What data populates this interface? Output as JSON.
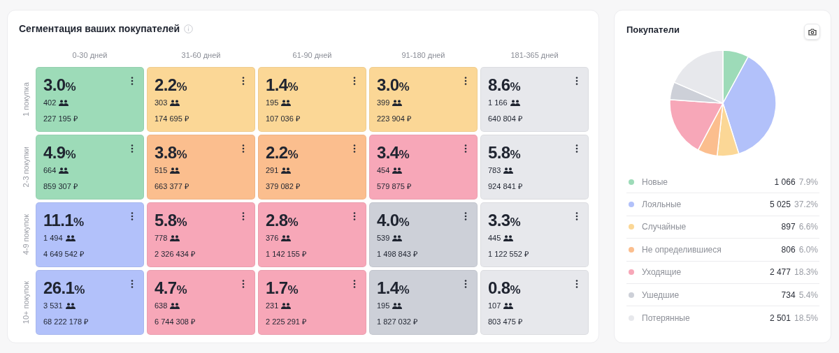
{
  "segmentation": {
    "title": "Сегментация ваших покупателей",
    "columns": [
      "0-30 дней",
      "31-60 дней",
      "61-90 дней",
      "91-180 дней",
      "181-365 дней"
    ],
    "rows": [
      {
        "label": "1 покупка",
        "cells": [
          {
            "value": "3.0",
            "unit": "%",
            "count": "402",
            "amount": "227 195 ₽",
            "color": "#9ddbb8"
          },
          {
            "value": "2.2",
            "unit": "%",
            "count": "303",
            "amount": "174 695 ₽",
            "color": "#fbd796"
          },
          {
            "value": "1.4",
            "unit": "%",
            "count": "195",
            "amount": "107 036 ₽",
            "color": "#fbd796"
          },
          {
            "value": "3.0",
            "unit": "%",
            "count": "399",
            "amount": "223 904 ₽",
            "color": "#fbd796"
          },
          {
            "value": "8.6",
            "unit": "%",
            "count": "1 166",
            "amount": "640 804 ₽",
            "color": "#e7e8ec"
          }
        ]
      },
      {
        "label": "2-3 покупки",
        "cells": [
          {
            "value": "4.9",
            "unit": "%",
            "count": "664",
            "amount": "859 307 ₽",
            "color": "#9ddbb8"
          },
          {
            "value": "3.8",
            "unit": "%",
            "count": "515",
            "amount": "663 377 ₽",
            "color": "#fbbe8e"
          },
          {
            "value": "2.2",
            "unit": "%",
            "count": "291",
            "amount": "379 082 ₽",
            "color": "#fbbe8e"
          },
          {
            "value": "3.4",
            "unit": "%",
            "count": "454",
            "amount": "579 875 ₽",
            "color": "#f7a7b8"
          },
          {
            "value": "5.8",
            "unit": "%",
            "count": "783",
            "amount": "924 841 ₽",
            "color": "#e7e8ec"
          }
        ]
      },
      {
        "label": "4-9 покупок",
        "cells": [
          {
            "value": "11.1",
            "unit": "%",
            "count": "1 494",
            "amount": "4 649 542 ₽",
            "color": "#b2c1fa"
          },
          {
            "value": "5.8",
            "unit": "%",
            "count": "778",
            "amount": "2 326 434 ₽",
            "color": "#f7a7b8"
          },
          {
            "value": "2.8",
            "unit": "%",
            "count": "376",
            "amount": "1 142 155 ₽",
            "color": "#f7a7b8"
          },
          {
            "value": "4.0",
            "unit": "%",
            "count": "539",
            "amount": "1 498 843 ₽",
            "color": "#cdd0d8"
          },
          {
            "value": "3.3",
            "unit": "%",
            "count": "445",
            "amount": "1 122 552 ₽",
            "color": "#e7e8ec"
          }
        ]
      },
      {
        "label": "10+ покупок",
        "cells": [
          {
            "value": "26.1",
            "unit": "%",
            "count": "3 531",
            "amount": "68 222 178 ₽",
            "color": "#b2c1fa"
          },
          {
            "value": "4.7",
            "unit": "%",
            "count": "638",
            "amount": "6 744 308 ₽",
            "color": "#f7a7b8"
          },
          {
            "value": "1.7",
            "unit": "%",
            "count": "231",
            "amount": "2 225 291 ₽",
            "color": "#f7a7b8"
          },
          {
            "value": "1.4",
            "unit": "%",
            "count": "195",
            "amount": "1 827 032 ₽",
            "color": "#cdd0d8"
          },
          {
            "value": "0.8",
            "unit": "%",
            "count": "107",
            "amount": "803 475 ₽",
            "color": "#e7e8ec"
          }
        ]
      }
    ]
  },
  "buyers": {
    "title": "Покупатели",
    "chart_data": {
      "type": "pie",
      "categories": [
        "Новые",
        "Лояльные",
        "Случайные",
        "Не определившиеся",
        "Уходящие",
        "Ушедшие",
        "Потерянные"
      ],
      "values": [
        7.9,
        37.2,
        6.6,
        6.0,
        18.3,
        5.4,
        18.5
      ]
    },
    "legend": [
      {
        "count": "1 066",
        "share": "7.9%",
        "color": "#9ddbb8"
      },
      {
        "count": "5 025",
        "share": "37.2%",
        "color": "#b2c1fa"
      },
      {
        "count": "897",
        "share": "6.6%",
        "color": "#fbd796"
      },
      {
        "count": "806",
        "share": "6.0%",
        "color": "#fbbe8e"
      },
      {
        "count": "2 477",
        "share": "18.3%",
        "color": "#f7a7b8"
      },
      {
        "count": "734",
        "share": "5.4%",
        "color": "#cdd0d8"
      },
      {
        "count": "2 501",
        "share": "18.5%",
        "color": "#e7e8ec"
      }
    ]
  }
}
